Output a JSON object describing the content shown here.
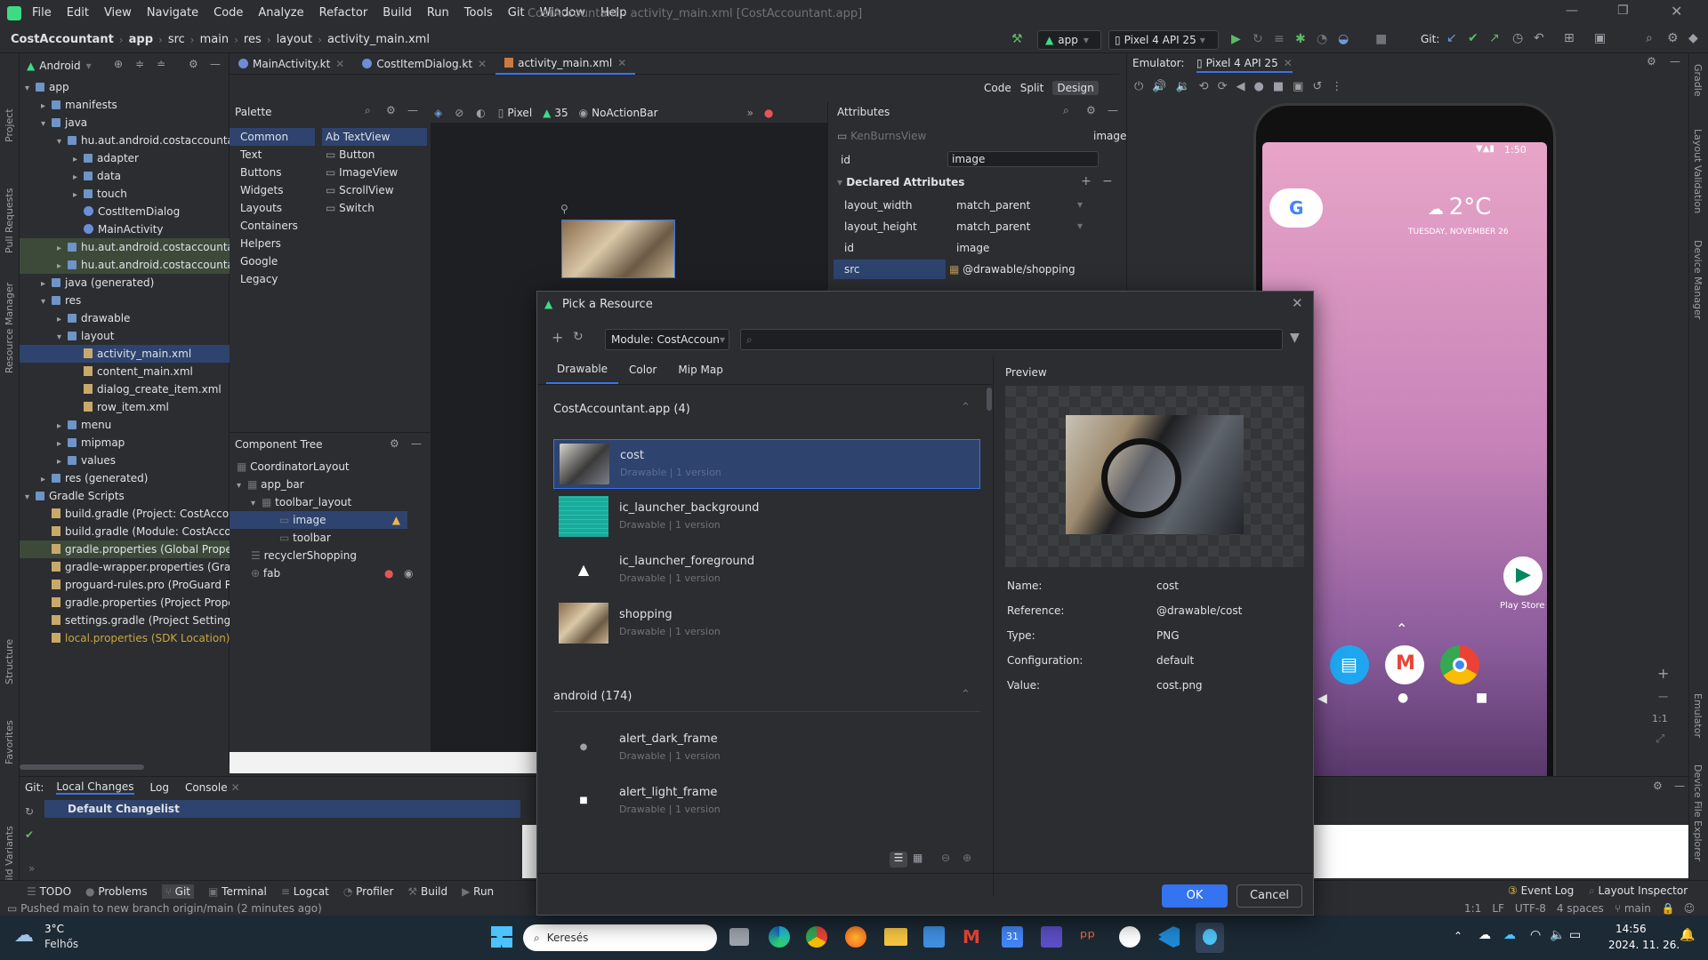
{
  "window": {
    "menu": [
      "File",
      "Edit",
      "View",
      "Navigate",
      "Code",
      "Analyze",
      "Refactor",
      "Build",
      "Run",
      "Tools",
      "Git",
      "Window",
      "Help"
    ],
    "title": "CostAccountant - activity_main.xml [CostAccountant.app]"
  },
  "breadcrumb": [
    "CostAccountant",
    "app",
    "src",
    "main",
    "res",
    "layout",
    "activity_main.xml"
  ],
  "toolbar": {
    "config": "app",
    "device": "Pixel 4 API 25",
    "git_label": "Git:"
  },
  "project": {
    "view": "Android",
    "items": [
      {
        "label": "app",
        "depth": 0,
        "type": "folder",
        "open": true
      },
      {
        "label": "manifests",
        "depth": 1,
        "type": "folder"
      },
      {
        "label": "java",
        "depth": 1,
        "type": "folder",
        "open": true
      },
      {
        "label": "hu.aut.android.costaccountant",
        "depth": 2,
        "type": "folder",
        "open": true
      },
      {
        "label": "adapter",
        "depth": 3,
        "type": "folder"
      },
      {
        "label": "data",
        "depth": 3,
        "type": "folder"
      },
      {
        "label": "touch",
        "depth": 3,
        "type": "folder"
      },
      {
        "label": "CostItemDialog",
        "depth": 3,
        "type": "kt"
      },
      {
        "label": "MainActivity",
        "depth": 3,
        "type": "kt"
      },
      {
        "label": "hu.aut.android.costaccountant",
        "depth": 2,
        "type": "folder",
        "hl": true
      },
      {
        "label": "hu.aut.android.costaccountant",
        "depth": 2,
        "type": "folder",
        "hl": true
      },
      {
        "label": "java (generated)",
        "depth": 1,
        "type": "folder"
      },
      {
        "label": "res",
        "depth": 1,
        "type": "folder",
        "open": true
      },
      {
        "label": "drawable",
        "depth": 2,
        "type": "folder"
      },
      {
        "label": "layout",
        "depth": 2,
        "type": "folder",
        "open": true
      },
      {
        "label": "activity_main.xml",
        "depth": 3,
        "type": "file",
        "sel": true
      },
      {
        "label": "content_main.xml",
        "depth": 3,
        "type": "file"
      },
      {
        "label": "dialog_create_item.xml",
        "depth": 3,
        "type": "file"
      },
      {
        "label": "row_item.xml",
        "depth": 3,
        "type": "file"
      },
      {
        "label": "menu",
        "depth": 2,
        "type": "folder"
      },
      {
        "label": "mipmap",
        "depth": 2,
        "type": "folder"
      },
      {
        "label": "values",
        "depth": 2,
        "type": "folder"
      },
      {
        "label": "res (generated)",
        "depth": 1,
        "type": "folder"
      },
      {
        "label": "Gradle Scripts",
        "depth": 0,
        "type": "folder",
        "open": true
      },
      {
        "label": "build.gradle (Project: CostAccou",
        "depth": 1,
        "type": "file"
      },
      {
        "label": "build.gradle (Module: CostAccou",
        "depth": 1,
        "type": "file"
      },
      {
        "label": "gradle.properties (Global Properti",
        "depth": 1,
        "type": "file",
        "hl": true
      },
      {
        "label": "gradle-wrapper.properties (Gradl",
        "depth": 1,
        "type": "file"
      },
      {
        "label": "proguard-rules.pro (ProGuard Ru",
        "depth": 1,
        "type": "file"
      },
      {
        "label": "gradle.properties (Project Propert",
        "depth": 1,
        "type": "file"
      },
      {
        "label": "settings.gradle (Project Settings)",
        "depth": 1,
        "type": "file"
      },
      {
        "label": "local.properties (SDK Location)",
        "depth": 1,
        "type": "file",
        "warn": true
      }
    ]
  },
  "tabs": [
    {
      "label": "MainActivity.kt"
    },
    {
      "label": "CostItemDialog.kt"
    },
    {
      "label": "activity_main.xml",
      "active": true
    }
  ],
  "palette": {
    "title": "Palette",
    "categories": [
      "Common",
      "Text",
      "Buttons",
      "Widgets",
      "Layouts",
      "Containers",
      "Helpers",
      "Google",
      "Legacy"
    ],
    "widgets": [
      "Ab TextView",
      "Button",
      "ImageView",
      "ScrollView",
      "Switch"
    ],
    "device": "Pixel",
    "api": "35",
    "theme": "NoActionBar"
  },
  "design_modes": [
    "Code",
    "Split",
    "Design"
  ],
  "component_tree": {
    "title": "Component Tree",
    "items": [
      "CoordinatorLayout",
      "app_bar",
      "toolbar_layout",
      "image",
      "toolbar",
      "recyclerShopping",
      "fab"
    ]
  },
  "attributes": {
    "title": "Attributes",
    "class": "KenBurnsView",
    "id_value": "image",
    "id_label": "id",
    "section": "Declared Attributes",
    "rows": [
      {
        "k": "layout_width",
        "v": "match_parent"
      },
      {
        "k": "layout_height",
        "v": "match_parent"
      },
      {
        "k": "id",
        "v": "image"
      },
      {
        "k": "src",
        "v": "@drawable/shopping"
      }
    ]
  },
  "emulator": {
    "label": "Emulator:",
    "device": "Pixel 4 API 25",
    "temp": "2°C",
    "date": "TUESDAY, NOVEMBER 26",
    "time": "1:50",
    "app": "Play Store",
    "zoom": "1:1"
  },
  "bottom": {
    "tabs": [
      "Git:",
      "Local Changes",
      "Log",
      "Console"
    ],
    "changelist": "Default Changelist"
  },
  "toolwindows": [
    "TODO",
    "Problems",
    "Git",
    "Terminal",
    "Logcat",
    "Profiler",
    "Build",
    "Run"
  ],
  "status": {
    "message": "Pushed main to new branch origin/main (2 minutes ago)",
    "right": [
      "1:1",
      "LF",
      "UTF-8",
      "4 spaces",
      "main"
    ],
    "event_log": "Event Log",
    "layout_inspector": "Layout Inspector"
  },
  "left_stripe": [
    "Project",
    "Pull Requests",
    "Resource Manager",
    "Structure",
    "Favorites",
    "Build Variants"
  ],
  "right_stripe": [
    "Gradle",
    "Layout Validation",
    "Device Manager",
    "Emulator",
    "Device File Explorer"
  ],
  "dialog": {
    "title": "Pick a Resource",
    "module": "Module: CostAccount",
    "search_placeholder": "",
    "tabs": [
      "Drawable",
      "Color",
      "Mip Map"
    ],
    "groups": [
      {
        "name": "CostAccountant.app (4)",
        "items": [
          {
            "name": "cost",
            "sub": "Drawable",
            "ver": "1 version",
            "sel": true
          },
          {
            "name": "ic_launcher_background",
            "sub": "Drawable",
            "ver": "1 version"
          },
          {
            "name": "ic_launcher_foreground",
            "sub": "Drawable",
            "ver": "1 version"
          },
          {
            "name": "shopping",
            "sub": "Drawable",
            "ver": "1 version"
          }
        ]
      },
      {
        "name": "android (174)",
        "items": [
          {
            "name": "alert_dark_frame",
            "sub": "Drawable",
            "ver": "1 version"
          },
          {
            "name": "alert_light_frame",
            "sub": "Drawable",
            "ver": "1 version"
          }
        ]
      }
    ],
    "preview_label": "Preview",
    "details": [
      {
        "k": "Name:",
        "v": "cost"
      },
      {
        "k": "Reference:",
        "v": "@drawable/cost"
      },
      {
        "k": "Type:",
        "v": "PNG"
      },
      {
        "k": "Configuration:",
        "v": "default"
      },
      {
        "k": "Value:",
        "v": "cost.png"
      }
    ],
    "ok": "OK",
    "cancel": "Cancel"
  },
  "taskbar": {
    "temp": "3°C",
    "weather": "Felhős",
    "search": "Keresés",
    "time": "14:56",
    "date": "2024. 11. 26."
  },
  "colors": {
    "accent": "#3574f0",
    "selection": "#2e436e",
    "bg": "#2b2d30",
    "editor_bg": "#1e1f22"
  }
}
